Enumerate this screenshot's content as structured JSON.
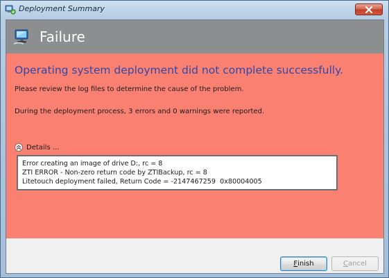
{
  "window": {
    "title": "Deployment Summary"
  },
  "banner": {
    "title": "Failure"
  },
  "summary": {
    "headline": "Operating system deployment did not complete successfully.",
    "review_message": "Please review the log files to determine the cause of the problem.",
    "counts_message": "During the deployment process, 3 errors and 0 warnings were reported.",
    "details_label": "Details ...",
    "details_lines": [
      "Error creating an image of drive D:, rc = 8",
      "ZTI ERROR - Non-zero return code by ZTIBackup, rc = 8",
      "Litetouch deployment failed, Return Code = -2147467259  0x80004005"
    ]
  },
  "buttons": {
    "finish": {
      "mnemonic": "F",
      "rest": "inish"
    },
    "cancel": {
      "mnemonic": "C",
      "rest": "ancel"
    }
  },
  "colors": {
    "failure_background": "#fa8072",
    "headline": "#3049a6",
    "banner": "#8c8e90"
  },
  "icons": {
    "title": "deployment-wizard-icon",
    "banner": "computer-icon",
    "details_toggle": "collapse-chevron-icon",
    "close": "close-icon"
  }
}
